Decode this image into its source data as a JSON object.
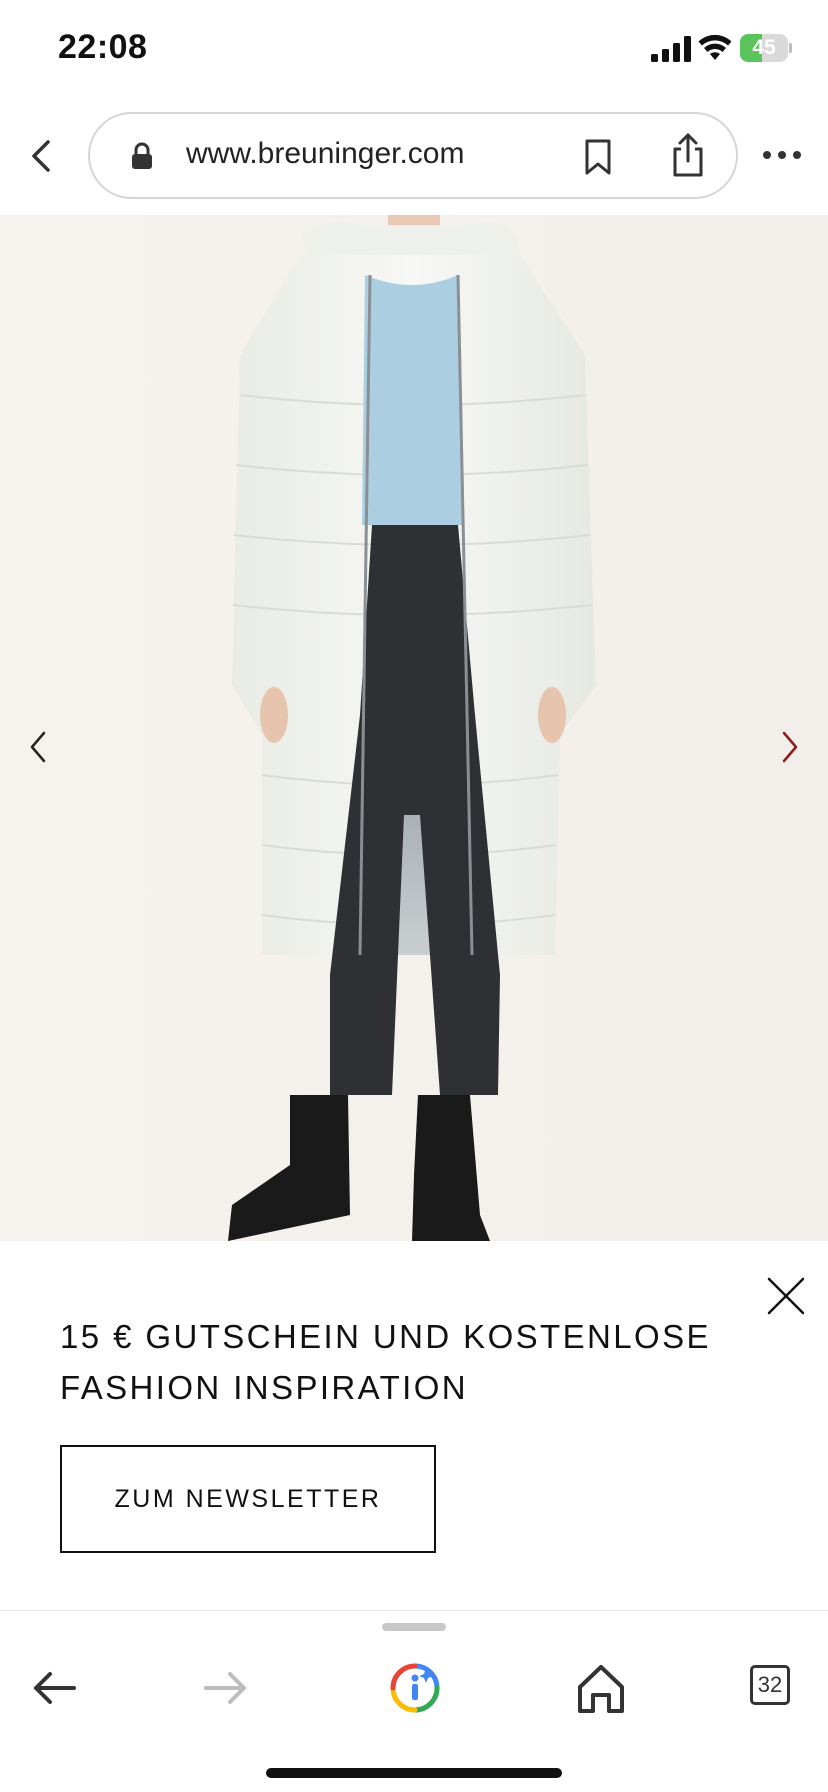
{
  "status_bar": {
    "time": "22:08",
    "battery_percent": "45",
    "battery_level": 0.45,
    "icons": [
      "signal-icon",
      "wifi-icon",
      "battery-icon"
    ]
  },
  "browser": {
    "url": "www.breuninger.com",
    "icons": [
      "back-chevron-icon",
      "lock-icon",
      "bookmark-icon",
      "share-icon",
      "more-icon"
    ]
  },
  "product_gallery": {
    "image_description_icon": "product-photo",
    "icons": [
      "chevron-left-icon",
      "chevron-right-icon"
    ],
    "accent_color": "#8b1a1a",
    "background_color": "#f5f1ed"
  },
  "newsletter": {
    "headline": "15 € GUTSCHEIN UND KOSTENLOSE FASHION INSPIRATION",
    "button_label": "ZUM NEWSLETTER",
    "close_icon": "close-icon"
  },
  "bottom_nav": {
    "tab_count": "32",
    "icons": [
      "arrow-left-icon",
      "arrow-right-icon",
      "google-lens-icon",
      "home-icon",
      "tabs-icon"
    ]
  }
}
